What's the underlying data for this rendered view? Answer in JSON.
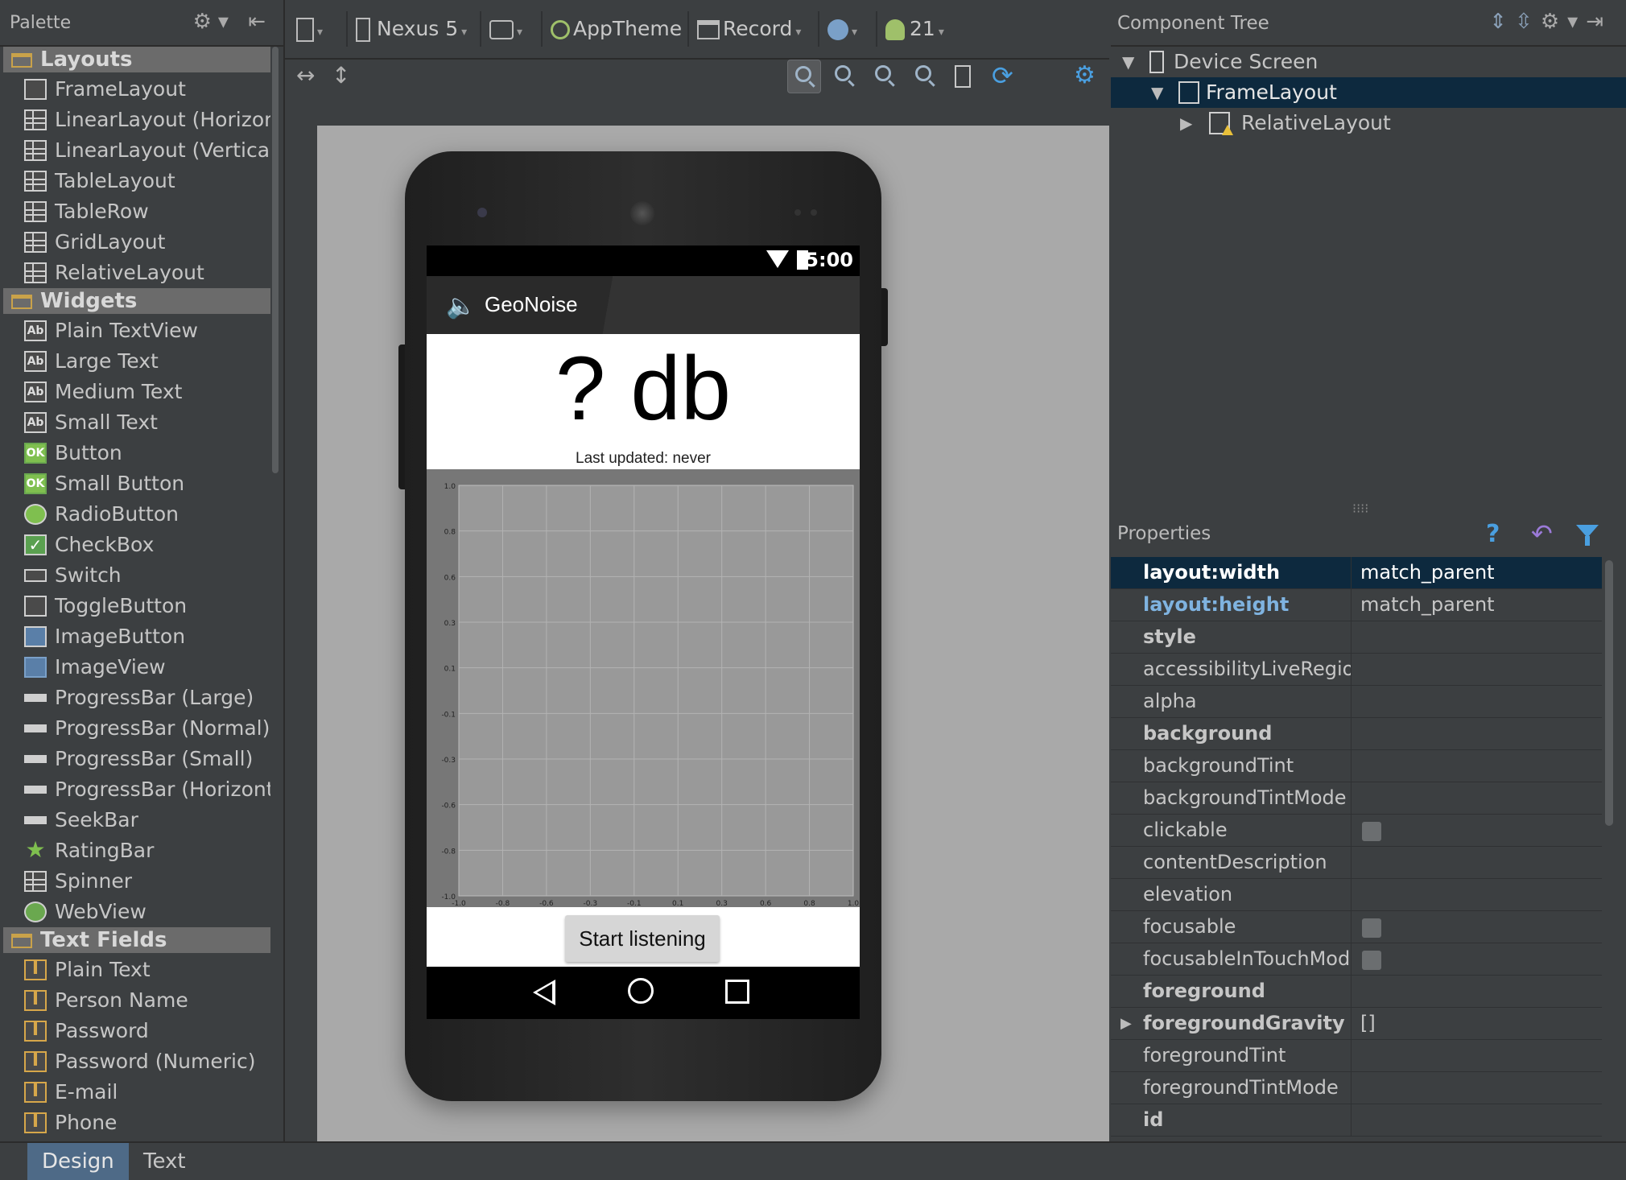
{
  "palette": {
    "title": "Palette",
    "groups": [
      {
        "name": "Layouts",
        "items": [
          "FrameLayout",
          "LinearLayout (Horizontal)",
          "LinearLayout (Vertical)",
          "TableLayout",
          "TableRow",
          "GridLayout",
          "RelativeLayout"
        ]
      },
      {
        "name": "Widgets",
        "items": [
          "Plain TextView",
          "Large Text",
          "Medium Text",
          "Small Text",
          "Button",
          "Small Button",
          "RadioButton",
          "CheckBox",
          "Switch",
          "ToggleButton",
          "ImageButton",
          "ImageView",
          "ProgressBar (Large)",
          "ProgressBar (Normal)",
          "ProgressBar (Small)",
          "ProgressBar (Horizontal)",
          "SeekBar",
          "RatingBar",
          "Spinner",
          "WebView"
        ]
      },
      {
        "name": "Text Fields",
        "items": [
          "Plain Text",
          "Person Name",
          "Password",
          "Password (Numeric)",
          "E-mail",
          "Phone"
        ]
      }
    ]
  },
  "toolbar": {
    "device": "Nexus 5",
    "theme": "AppTheme",
    "activity": "Record",
    "api": "21"
  },
  "phone": {
    "status_time": "5:00",
    "app_title": "GeoNoise",
    "db_text": "? db",
    "last_updated": "Last updated: never",
    "start_button": "Start listening"
  },
  "chart_data": {
    "type": "line",
    "title": "",
    "xlabel": "",
    "ylabel": "",
    "y_ticks": [
      "1.0",
      "0.8",
      "0.6",
      "0.3",
      "0.1",
      "-0.1",
      "-0.3",
      "-0.6",
      "-0.8",
      "-1.0"
    ],
    "x_ticks": [
      "-1.0",
      "-0.8",
      "-0.6",
      "-0.3",
      "-0.1",
      "0.1",
      "0.3",
      "0.6",
      "0.8",
      "1.0"
    ],
    "xlim": [
      -1.0,
      1.0
    ],
    "ylim": [
      -1.0,
      1.0
    ],
    "grid": true,
    "series": []
  },
  "component_tree": {
    "title": "Component Tree",
    "nodes": [
      {
        "label": "Device Screen"
      },
      {
        "label": "FrameLayout"
      },
      {
        "label": "RelativeLayout"
      }
    ]
  },
  "properties": {
    "title": "Properties",
    "rows": [
      {
        "name": "layout:width",
        "value": "match_parent"
      },
      {
        "name": "layout:height",
        "value": "match_parent"
      },
      {
        "name": "style",
        "value": ""
      },
      {
        "name": "accessibilityLiveRegion",
        "value": ""
      },
      {
        "name": "alpha",
        "value": ""
      },
      {
        "name": "background",
        "value": ""
      },
      {
        "name": "backgroundTint",
        "value": ""
      },
      {
        "name": "backgroundTintMode",
        "value": ""
      },
      {
        "name": "clickable",
        "value": ""
      },
      {
        "name": "contentDescription",
        "value": ""
      },
      {
        "name": "elevation",
        "value": ""
      },
      {
        "name": "focusable",
        "value": ""
      },
      {
        "name": "focusableInTouchMode",
        "value": ""
      },
      {
        "name": "foreground",
        "value": ""
      },
      {
        "name": "foregroundGravity",
        "value": "[]"
      },
      {
        "name": "foregroundTint",
        "value": ""
      },
      {
        "name": "foregroundTintMode",
        "value": ""
      },
      {
        "name": "id",
        "value": ""
      }
    ]
  },
  "bottom_tabs": [
    "Design",
    "Text"
  ]
}
